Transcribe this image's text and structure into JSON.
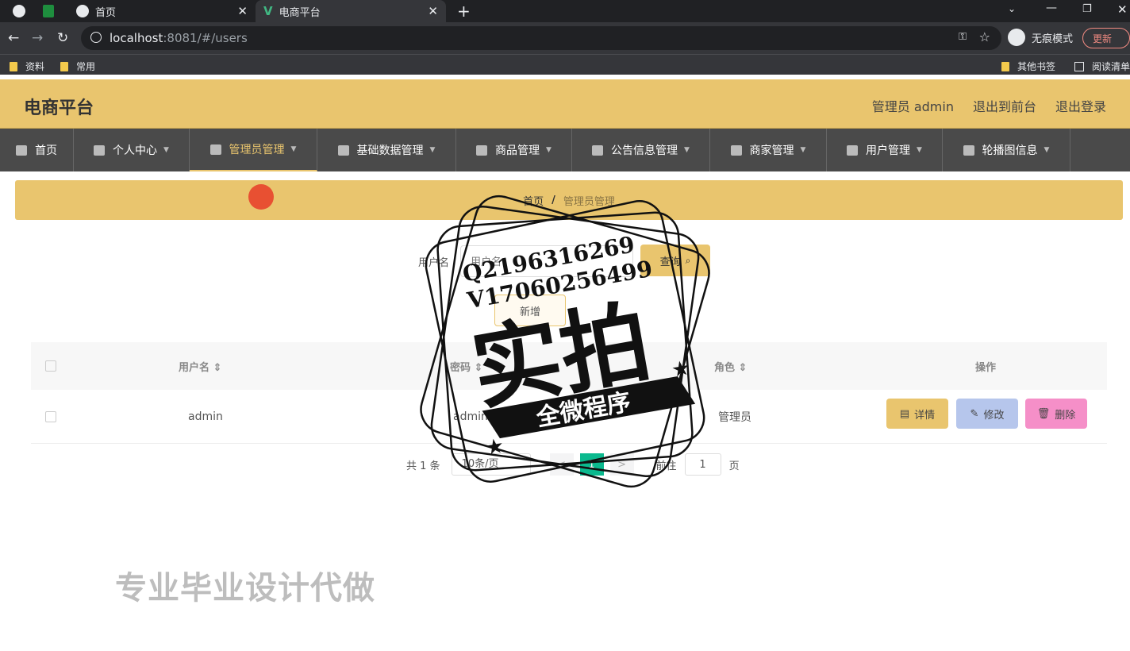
{
  "browser": {
    "tabs": [
      {
        "title": "首页"
      },
      {
        "title": "电商平台"
      }
    ],
    "url_host": "localhost",
    "url_path": ":8081/#/users",
    "incognito_label": "无痕模式",
    "update_label": "更新",
    "bookmarks": [
      "资料",
      "常用"
    ],
    "other_bookmarks": "其他书签",
    "reading_list": "阅读清单"
  },
  "header": {
    "title": "电商平台",
    "admin_label": "管理员 admin",
    "front_link": "退出到前台",
    "logout_link": "退出登录"
  },
  "menu": {
    "items": [
      "首页",
      "个人中心",
      "管理员管理",
      "基础数据管理",
      "商品管理",
      "公告信息管理",
      "商家管理",
      "用户管理",
      "轮播图信息"
    ]
  },
  "breadcrumb": {
    "home": "首页",
    "sep": "/",
    "current": "管理员管理"
  },
  "search": {
    "label": "用户名",
    "placeholder": "用户名",
    "query_button": "查询",
    "add_button": "新增"
  },
  "table": {
    "headers": [
      "用户名",
      "密码",
      "角色",
      "操作"
    ],
    "rows": [
      {
        "username": "admin",
        "password": "admin",
        "role": "管理员"
      }
    ],
    "actions": [
      "详情",
      "修改",
      "删除"
    ]
  },
  "pagination": {
    "total": "共 1 条",
    "page_size": "10条/页",
    "prev": "<",
    "current": "1",
    "next": ">",
    "goto": "前往",
    "goto_value": "1",
    "page_suffix": "页"
  },
  "overlay": {
    "stamp_qq": "Q2196316269",
    "stamp_v": "V17060256499",
    "stamp_big": "实拍",
    "stamp_banner": "全微程序",
    "watermark": "专业毕业设计代做"
  },
  "colors": {
    "accent": "#e9c56e",
    "menu_bg": "#4a4a4a",
    "pager_active": "#0bb98e",
    "edit_btn": "#b6c6ec",
    "delete_btn": "#f58fc8"
  }
}
